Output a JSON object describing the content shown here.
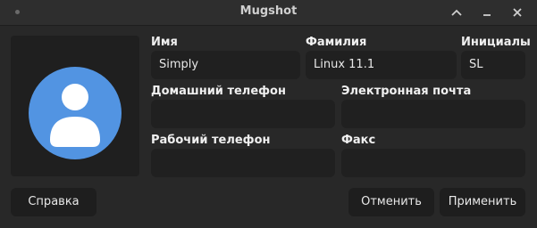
{
  "window": {
    "title": "Mugshot"
  },
  "form": {
    "first_name_label": "Имя",
    "first_name_value": "Simply",
    "last_name_label": "Фамилия",
    "last_name_value": "Linux 11.1",
    "initials_label": "Инициалы",
    "initials_value": "SL",
    "home_phone_label": "Домашний телефон",
    "home_phone_value": "",
    "email_label": "Электронная почта",
    "email_value": "",
    "work_phone_label": "Рабочий телефон",
    "work_phone_value": "",
    "fax_label": "Факс",
    "fax_value": ""
  },
  "buttons": {
    "help": "Справка",
    "cancel": "Отменить",
    "apply": "Применить"
  },
  "colors": {
    "avatar": "#5294e2",
    "background": "#282828",
    "field": "#202020"
  }
}
